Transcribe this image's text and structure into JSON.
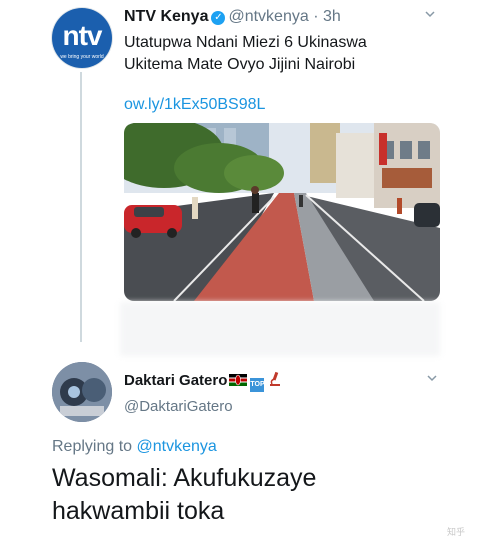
{
  "tweet1": {
    "display_name": "NTV Kenya",
    "handle": "@ntvkenya",
    "separator": "·",
    "time": "3h",
    "text_line1": "Utatupwa Ndani Miezi 6 Ukinaswa",
    "text_line2": "Ukitema Mate Ovyo Jijini Nairobi",
    "link": "ow.ly/1kEx50BS98L",
    "avatar_logo": "ntv",
    "avatar_tagline": "we bring your world"
  },
  "tweet2": {
    "display_name": "Daktari Gatero",
    "handle": "@DaktariGatero",
    "badge_top": "TOP",
    "replying_prefix": "Replying to",
    "replying_to": "@ntvkenya",
    "text_line1": "Wasomali: Akufukuzaye",
    "text_line2": "hakwambii toka"
  },
  "icons": {
    "verified": "verified-check-icon",
    "chevron": "chevron-down-icon",
    "flag": "kenya-flag-icon",
    "top_badge": "top-arrow-badge-icon",
    "microscope": "microscope-icon"
  },
  "colors": {
    "link": "#1b95e0",
    "verified": "#1da1f2",
    "muted": "#657786",
    "thread_line": "#cfd9de"
  },
  "watermark": "知乎"
}
